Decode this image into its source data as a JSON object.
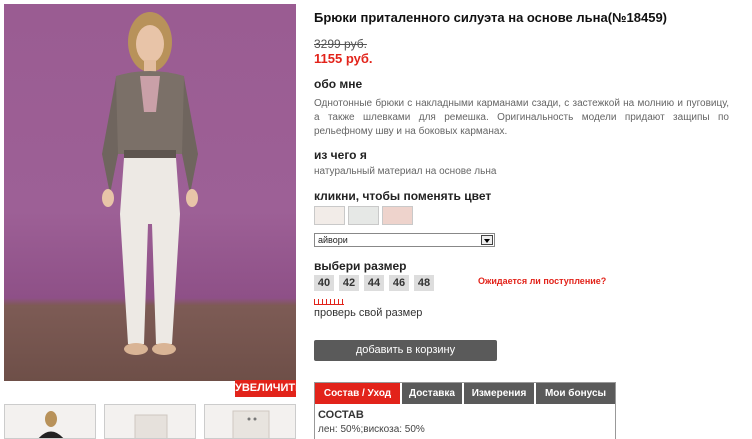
{
  "product": {
    "title": "Брюки приталенного силуэта на основе льна(№18459)",
    "old_price": "3299 руб.",
    "new_price": "1155 руб."
  },
  "gallery": {
    "zoom_label": "УВЕЛИЧИТЬ"
  },
  "about": {
    "heading": "обо мне",
    "text": "Однотонные брюки с накладными карманами сзади, с застежкой на молнию и пуговицу, а также шлевками для ремешка. Оригинальность модели придают защипы по рельефному шву и на боковых карманах."
  },
  "material": {
    "heading": "из чего я",
    "text": "натуральный материал на основе льна"
  },
  "colors": {
    "heading": "кликни, чтобы поменять цвет",
    "swatches": [
      "#f2ece8",
      "#e6e8e6",
      "#eed3cc"
    ],
    "selected": "айвори"
  },
  "sizes": {
    "heading": "выбери размер",
    "items": [
      "40",
      "42",
      "44",
      "46",
      "48"
    ],
    "arrival_link": "Ожидается ли поступление?",
    "check_label": "проверь свой размер"
  },
  "cart": {
    "button_label": "добавить в корзину"
  },
  "tabs": {
    "items": [
      "Состав / Уход",
      "Доставка",
      "Измерения",
      "Мои бонусы"
    ],
    "content_heading": "СОСТАВ",
    "content_text": "лен: 50%;вискоза: 50%"
  },
  "accent_color": "#e2231a"
}
